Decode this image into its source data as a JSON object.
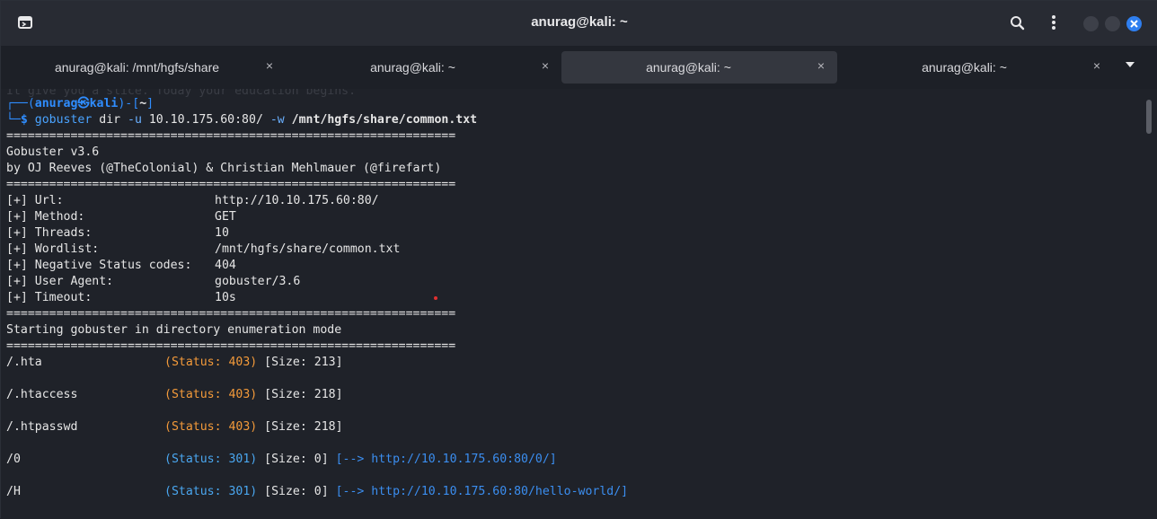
{
  "window": {
    "title": "anurag@kali: ~"
  },
  "tabs": [
    {
      "label": "anurag@kali: /mnt/hgfs/share",
      "active": false
    },
    {
      "label": "anurag@kali: ~",
      "active": false
    },
    {
      "label": "anurag@kali: ~",
      "active": true
    },
    {
      "label": "anurag@kali: ~",
      "active": false
    }
  ],
  "icons": {
    "terminal": "terminal-icon",
    "search": "search-icon",
    "menu": "kebab-menu-icon",
    "minimize": "minimize-icon",
    "maximize": "maximize-icon",
    "close": "close-icon",
    "tab_close": "×",
    "tab_list": "chevron-down-icon"
  },
  "colors": {
    "prompt": "#2f8dff",
    "status_403": "#f39a3a",
    "status_301": "#4aa7f0",
    "window_close": "#2f7ff0"
  },
  "terminal": {
    "ghost_line": "It give you a slice. Today your education begins.",
    "prompt": {
      "top_left": "┌──(",
      "user_host": "anurag㉿kali",
      "mid": ")-[",
      "dir": "~",
      "end": "]",
      "bottom_left": "└─",
      "dollar": "$ "
    },
    "command": {
      "program": "gobuster",
      "sub": " dir ",
      "flag_u": "-u",
      "url": " 10.10.175.60:80/ ",
      "flag_w": "-w",
      "wordlist": " /mnt/hgfs/share/common.txt"
    },
    "separator": "===============================================================",
    "banner": [
      "Gobuster v3.6",
      "by OJ Reeves (@TheColonial) & Christian Mehlmauer (@firefart)"
    ],
    "config": [
      {
        "key": "[+] Url:",
        "value": "http://10.10.175.60:80/"
      },
      {
        "key": "[+] Method:",
        "value": "GET"
      },
      {
        "key": "[+] Threads:",
        "value": "10"
      },
      {
        "key": "[+] Wordlist:",
        "value": "/mnt/hgfs/share/common.txt"
      },
      {
        "key": "[+] Negative Status codes:",
        "value": "404"
      },
      {
        "key": "[+] User Agent:",
        "value": "gobuster/3.6"
      },
      {
        "key": "[+] Timeout:",
        "value": "10s"
      }
    ],
    "start_msg": "Starting gobuster in directory enumeration mode",
    "results": [
      {
        "path": "/.hta",
        "status": "(Status: 403)",
        "size": "[Size: 213]",
        "redirect": "",
        "code": 403
      },
      {
        "path": "/.htaccess",
        "status": "(Status: 403)",
        "size": "[Size: 218]",
        "redirect": "",
        "code": 403
      },
      {
        "path": "/.htpasswd",
        "status": "(Status: 403)",
        "size": "[Size: 218]",
        "redirect": "",
        "code": 403
      },
      {
        "path": "/0",
        "status": "(Status: 301)",
        "size": "[Size: 0]",
        "redirect": "[--> http://10.10.175.60:80/0/]",
        "code": 301
      },
      {
        "path": "/H",
        "status": "(Status: 301)",
        "size": "[Size: 0]",
        "redirect": "[--> http://10.10.175.60:80/hello-world/]",
        "code": 301
      }
    ]
  }
}
